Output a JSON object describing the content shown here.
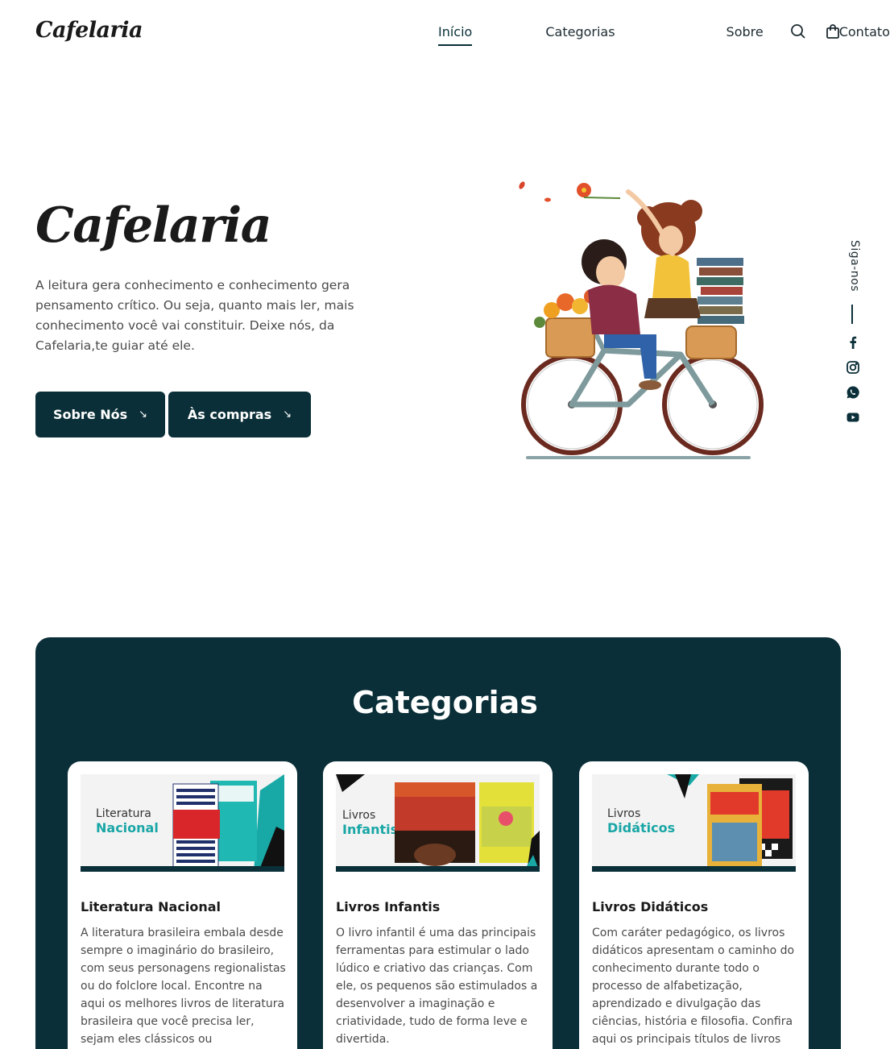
{
  "brand": {
    "logo": "Cafelaria"
  },
  "nav": {
    "items": [
      "Início",
      "Categorias",
      "Sobre",
      "Contato"
    ]
  },
  "header_icons": [
    "search-icon",
    "shopping-bag-icon"
  ],
  "hero": {
    "title": "Cafelaria",
    "text": "A leitura gera conhecimento e conhecimento gera pensamento crítico. Ou seja, quanto mais ler, mais conhecimento você vai constituir. Deixe nós, da Cafelaria,te guiar até ele.",
    "buttons": [
      {
        "label": "Sobre Nós",
        "icon": "arrow-down-right-icon"
      },
      {
        "label": "Às compras",
        "icon": "arrow-down-right-icon"
      }
    ],
    "illustration": "couple-on-bicycle-with-books"
  },
  "social": {
    "label": "Siga-nos",
    "icons": [
      "facebook-icon",
      "instagram-icon",
      "whatsapp-icon",
      "youtube-icon"
    ]
  },
  "categories": {
    "title": "Categorias",
    "cards": [
      {
        "banner_line1": "Literatura",
        "banner_line2": "Nacional",
        "heading": "Literatura Nacional",
        "text": " A literatura brasileira embala desde sempre o imaginário do brasileiro, com seus personagens regionalistas ou do folclore local. Encontre na aqui os melhores livros de literatura brasileira que você precisa ler, sejam eles clássicos ou"
      },
      {
        "banner_line1": "Livros",
        "banner_line2": "Infantis",
        "heading": "Livros Infantis",
        "text": " O livro infantil é uma das principais ferramentas para estimular o lado lúdico e criativo das crianças. Com ele, os pequenos são estimulados a desenvolver a imaginação e criatividade, tudo de forma leve e divertida."
      },
      {
        "banner_line1": "Livros",
        "banner_line2": "Didáticos",
        "heading": "Livros Didáticos",
        "text": " Com caráter pedagógico, os livros didáticos apresentam o caminho do conhecimento durante todo o processo de alfabetização, aprendizado e divulgação das ciências, história e filosofia. Confira aqui os principais títulos de livros"
      }
    ]
  },
  "colors": {
    "primary": "#0a2f38",
    "accent": "#1aa6a6",
    "text": "#4a4a4a"
  }
}
